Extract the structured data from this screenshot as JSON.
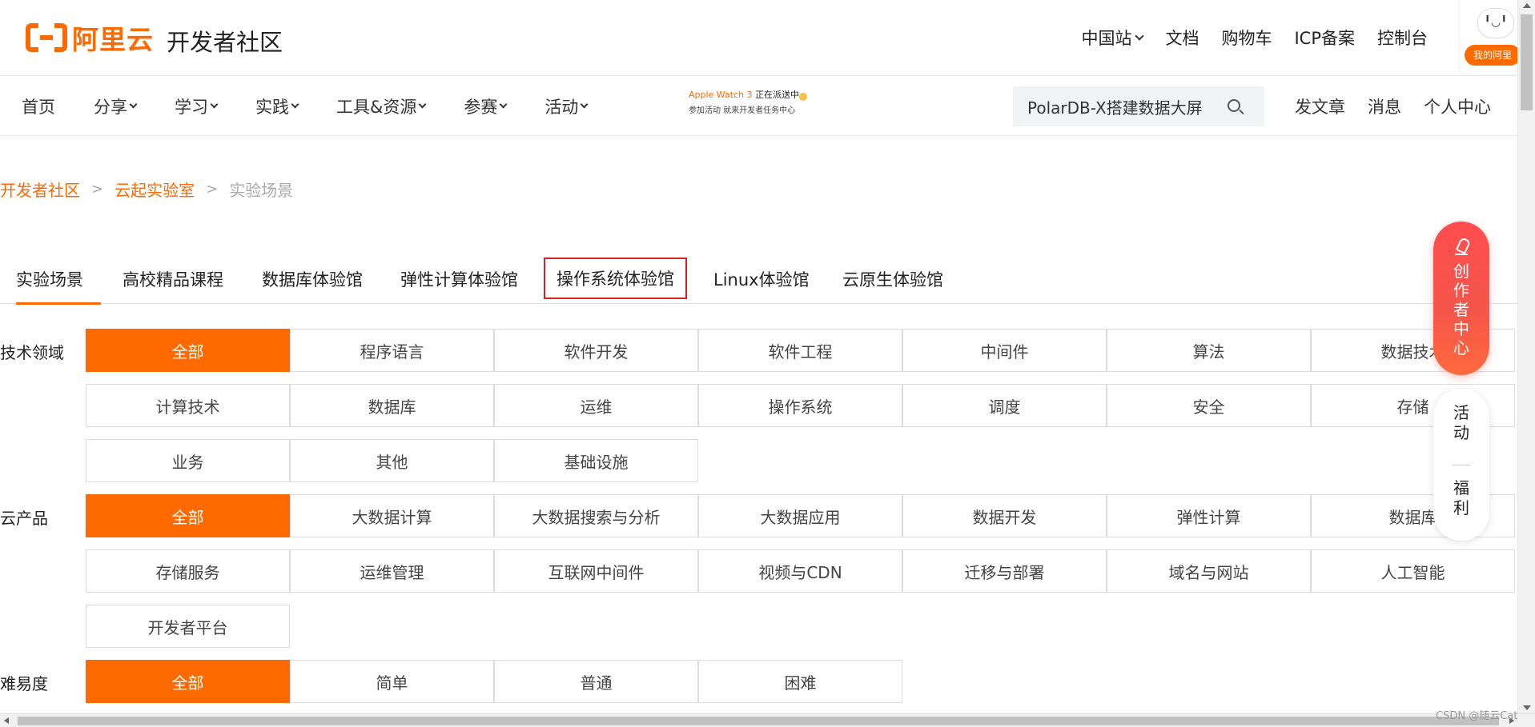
{
  "header": {
    "logo_text": "阿里云",
    "site_title": "开发者社区",
    "region": "中国站",
    "links": [
      "文档",
      "购物车",
      "ICP备案",
      "控制台"
    ],
    "avatar_face": "╹◡╹",
    "avatar_label": "我的阿里"
  },
  "nav": {
    "items": [
      {
        "label": "首页",
        "has_dropdown": false
      },
      {
        "label": "分享",
        "has_dropdown": true
      },
      {
        "label": "学习",
        "has_dropdown": true
      },
      {
        "label": "实践",
        "has_dropdown": true
      },
      {
        "label": "工具&资源",
        "has_dropdown": true
      },
      {
        "label": "参赛",
        "has_dropdown": true
      },
      {
        "label": "活动",
        "has_dropdown": true
      }
    ],
    "promo_line1_brand": "Apple Watch 3",
    "promo_line1_rest": "正在派送中",
    "promo_line2": "参加活动 就来开发者任务中心",
    "search_value": "PolarDB-X搭建数据大屏",
    "right_links": [
      "发文章",
      "消息",
      "个人中心"
    ]
  },
  "breadcrumb": {
    "items": [
      "开发者社区",
      "云起实验室"
    ],
    "current": "实验场景"
  },
  "tabs": [
    {
      "label": "实验场景",
      "active": true,
      "highlighted": false
    },
    {
      "label": "高校精品课程",
      "active": false,
      "highlighted": false
    },
    {
      "label": "数据库体验馆",
      "active": false,
      "highlighted": false
    },
    {
      "label": "弹性计算体验馆",
      "active": false,
      "highlighted": false
    },
    {
      "label": "操作系统体验馆",
      "active": false,
      "highlighted": true
    },
    {
      "label": "Linux体验馆",
      "active": false,
      "highlighted": false
    },
    {
      "label": "云原生体验馆",
      "active": false,
      "highlighted": false
    }
  ],
  "filters": [
    {
      "label": "技术领域",
      "options": [
        "全部",
        "程序语言",
        "软件开发",
        "软件工程",
        "中间件",
        "算法",
        "数据技术",
        "计算技术",
        "数据库",
        "运维",
        "操作系统",
        "调度",
        "安全",
        "存储",
        "业务",
        "其他",
        "基础设施"
      ],
      "selected": "全部"
    },
    {
      "label": "云产品",
      "options": [
        "全部",
        "大数据计算",
        "大数据搜索与分析",
        "大数据应用",
        "数据开发",
        "弹性计算",
        "数据库",
        "存储服务",
        "运维管理",
        "互联网中间件",
        "视频与CDN",
        "迁移与部署",
        "域名与网站",
        "人工智能",
        "开发者平台"
      ],
      "selected": "全部"
    },
    {
      "label": "难易度",
      "options": [
        "全部",
        "简单",
        "普通",
        "困难"
      ],
      "selected": "全部"
    }
  ],
  "side": {
    "creator_label": "创作者中心",
    "welfare_top": "活动",
    "welfare_bottom": "福利"
  },
  "watermark": "CSDN @随云Cat",
  "colors": {
    "accent": "#ff6a00",
    "creator_gradient": "#ff4d4f",
    "highlight_box": "#e02020"
  }
}
